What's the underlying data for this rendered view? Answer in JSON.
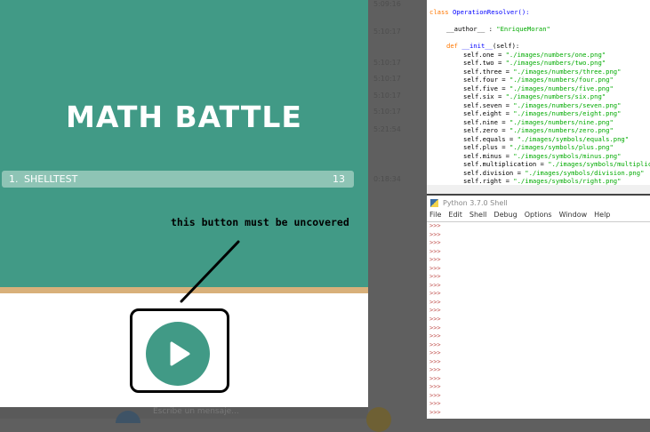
{
  "game": {
    "title": "MATH BATTLE",
    "leaderboard": [
      {
        "rank": "1.",
        "name": "SHELLTEST",
        "score": "13"
      }
    ],
    "annotation": "this button must be uncovered",
    "play_icon": "play-icon",
    "colors": {
      "teal": "#419a86",
      "stripe": "#d8b07a",
      "row": "#8ec4b5"
    }
  },
  "chat": {
    "placeholder": "Escribe un mensaje..."
  },
  "timestamps": [
    "5:09:16",
    "5:10:17",
    "5:10:17",
    "5:10:17",
    "5:10:17",
    "5:10:17",
    "5:21:54",
    "0:18:34"
  ],
  "editor": {
    "lines": [
      {
        "t": "class",
        "c": "kw"
      },
      "__author__ : \"EnriqueMoran\"",
      "def __init__(self):",
      "self.one = \"./images/numbers/one.png\"",
      "self.two = \"./images/numbers/two.png\"",
      "self.three = \"./images/numbers/three.png\"",
      "self.four = \"./images/numbers/four.png\"",
      "self.five = \"./images/numbers/five.png\"",
      "self.six = \"./images/numbers/six.png\"",
      "self.seven = \"./images/numbers/seven.png\"",
      "self.eight = \"./images/numbers/eight.png\"",
      "self.nine = \"./images/numbers/nine.png\"",
      "self.zero = \"./images/numbers/zero.png\"",
      "self.equals = \"./images/symbols/equals.png\"",
      "self.plus = \"./images/symbols/plus.png\"",
      "self.minus = \"./images/symbols/minus.png\"",
      "self.multiplication = \"./images/symbols/multiplication.png\"",
      "self.division = \"./images/symbols/division.png\"",
      "self.right = \"./images/symbols/right.png\""
    ],
    "class_name": "OperationResolver():"
  },
  "shell": {
    "title": "Python 3.7.0 Shell",
    "menu": [
      "File",
      "Edit",
      "Shell",
      "Debug",
      "Options",
      "Window",
      "Help"
    ],
    "prompt": ">>>",
    "prompt_count": 23
  }
}
